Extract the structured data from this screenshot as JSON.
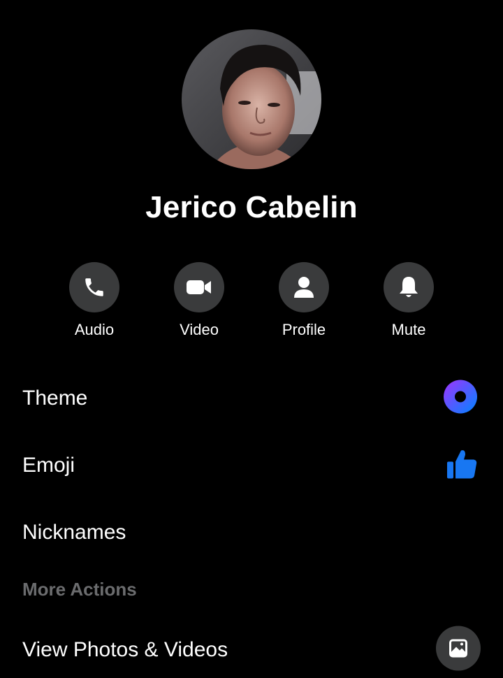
{
  "profile": {
    "name": "Jerico Cabelin"
  },
  "actions": [
    {
      "label": "Audio",
      "icon": "phone-icon"
    },
    {
      "label": "Video",
      "icon": "video-camera-icon"
    },
    {
      "label": "Profile",
      "icon": "person-icon"
    },
    {
      "label": "Mute",
      "icon": "bell-icon"
    }
  ],
  "settings": {
    "theme_label": "Theme",
    "emoji_label": "Emoji",
    "nicknames_label": "Nicknames"
  },
  "more_actions": {
    "header": "More Actions",
    "view_media_label": "View Photos & Videos"
  },
  "colors": {
    "background": "#000000",
    "button_bg": "#3a3b3c",
    "theme_gradient_start": "#a033ff",
    "theme_gradient_end": "#0084ff",
    "emoji_blue": "#1877f2",
    "section_header": "#6b6c6e"
  }
}
